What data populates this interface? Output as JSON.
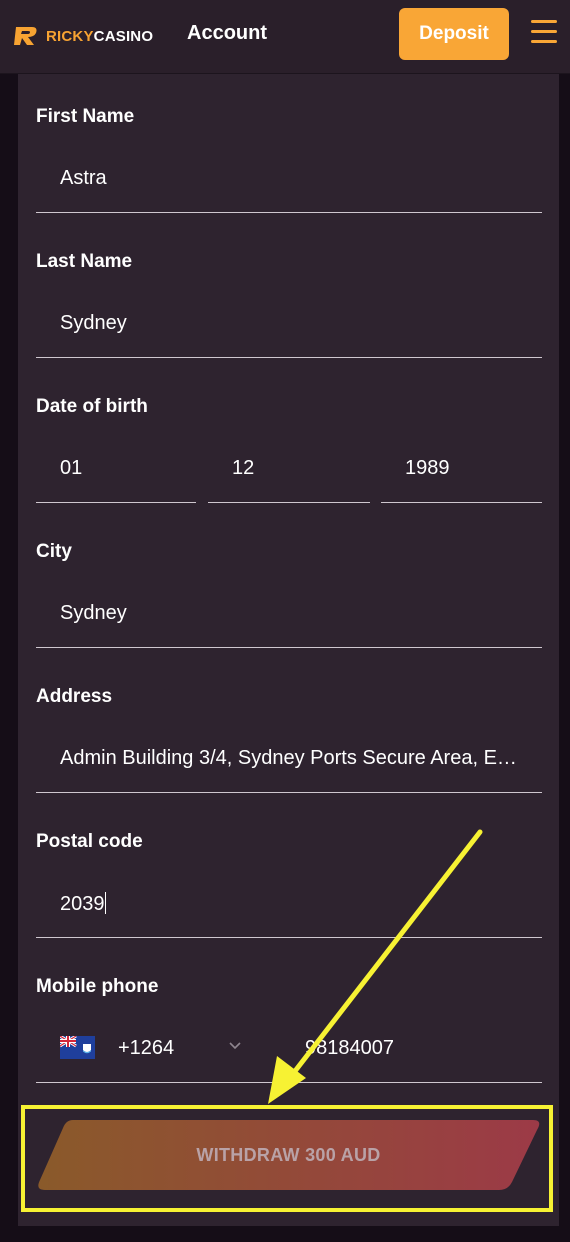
{
  "header": {
    "logo_ricky": "RICKY",
    "logo_casino": "CASINO",
    "title": "Account",
    "deposit_label": "Deposit"
  },
  "form": {
    "first_name": {
      "label": "First Name",
      "value": "Astra"
    },
    "last_name": {
      "label": "Last Name",
      "value": "Sydney"
    },
    "dob": {
      "label": "Date of birth",
      "day": "01",
      "month": "12",
      "year": "1989"
    },
    "city": {
      "label": "City",
      "value": "Sydney"
    },
    "address": {
      "label": "Address",
      "value": "Admin Building 3/4, Sydney Ports Secure Area, E…"
    },
    "postal_code": {
      "label": "Postal code",
      "value": "2039"
    },
    "mobile_phone": {
      "label": "Mobile phone",
      "country_code": "+1264",
      "number": "98184007"
    }
  },
  "withdraw": {
    "label": "WITHDRAW 300 AUD"
  },
  "icons": {
    "logo": "ricky-logo-icon",
    "menu": "hamburger-menu-icon",
    "flag": "anguilla-flag-icon",
    "dropdown": "chevron-down-icon"
  },
  "colors": {
    "accent": "#f9a636",
    "background": "#150d17",
    "panel": "#2e232f",
    "highlight": "#f7f233"
  }
}
